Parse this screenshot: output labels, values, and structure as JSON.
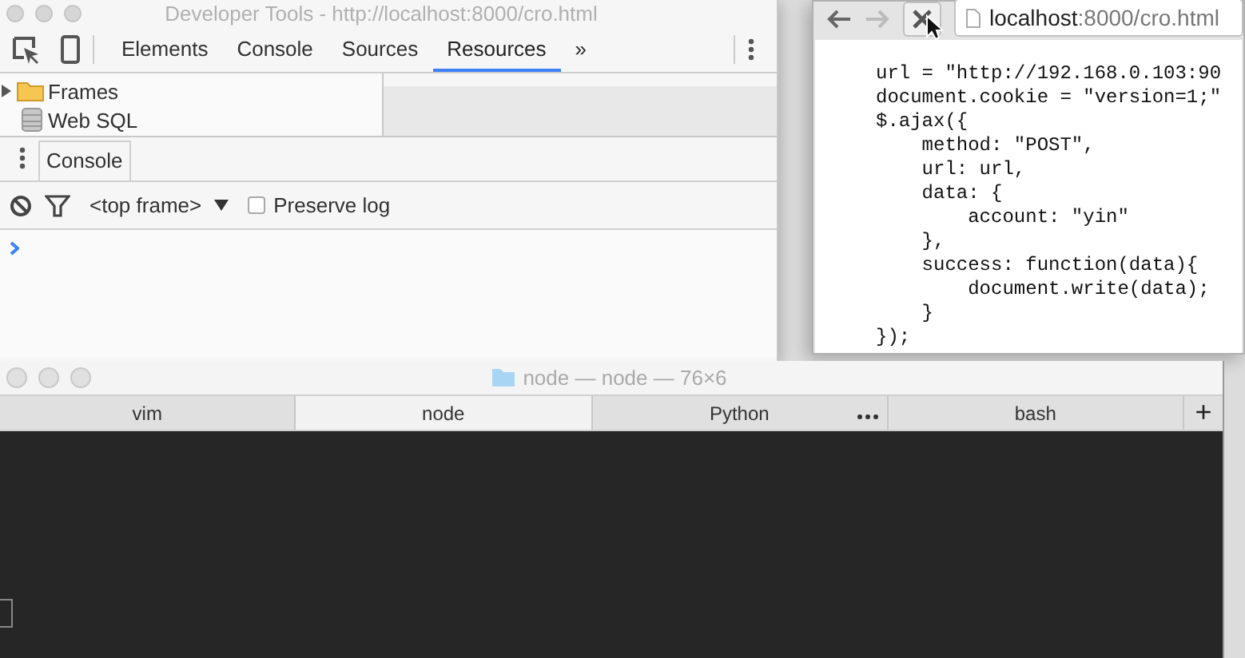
{
  "devtools": {
    "title": "Developer Tools - http://localhost:8000/cro.html",
    "tabs": [
      {
        "label": "Elements",
        "selected": false
      },
      {
        "label": "Console",
        "selected": false
      },
      {
        "label": "Sources",
        "selected": false
      },
      {
        "label": "Resources",
        "selected": true
      }
    ],
    "more_tabs": "»",
    "sidebar": [
      {
        "label": "Frames",
        "kind": "folder"
      },
      {
        "label": "Web SQL",
        "kind": "database"
      }
    ],
    "drawer_tab": "Console",
    "context": "<top frame>",
    "preserve_log": {
      "label": "Preserve log",
      "checked": false
    }
  },
  "browser": {
    "url_host": "localhost",
    "url_path": ":8000/cro.html",
    "code": [
      "url = \"http://192.168.0.103:90",
      "document.cookie = \"version=1;\"",
      "$.ajax({",
      "    method: \"POST\",",
      "    url: url,",
      "    data: {",
      "        account: \"yin\"",
      "    },",
      "    success: function(data){",
      "        document.write(data);",
      "    }",
      "});"
    ]
  },
  "terminal": {
    "title": "node — node — 76×6",
    "tabs": [
      {
        "label": "vim",
        "selected": false
      },
      {
        "label": "node",
        "selected": true
      },
      {
        "label": "Python",
        "selected": false
      },
      {
        "label": "bash",
        "selected": false
      }
    ],
    "new_tab": "+"
  }
}
